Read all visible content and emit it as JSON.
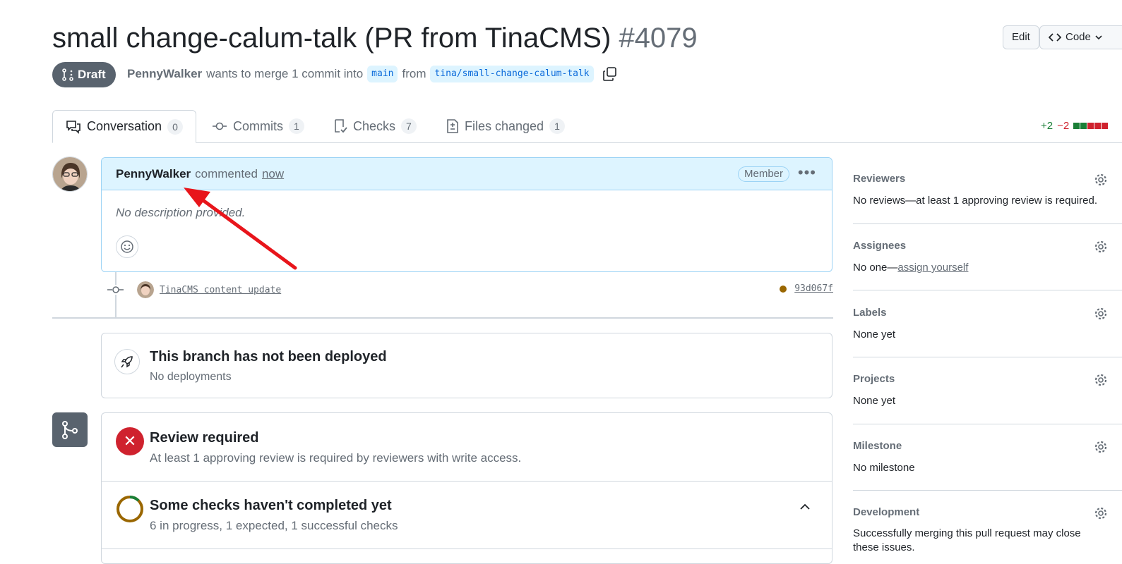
{
  "header": {
    "title": "small change-calum-talk (PR from TinaCMS)",
    "number": "#4079",
    "edit_label": "Edit",
    "code_label": "Code"
  },
  "state": {
    "badge": "Draft",
    "author": "PennyWalker",
    "merge_text": "wants to merge 1 commit into",
    "base_branch": "main",
    "from_text": "from",
    "head_branch": "tina/small-change-calum-talk"
  },
  "tabs": [
    {
      "label": "Conversation",
      "count": "0",
      "icon": "comment-discussion-icon"
    },
    {
      "label": "Commits",
      "count": "1",
      "icon": "git-commit-icon"
    },
    {
      "label": "Checks",
      "count": "7",
      "icon": "checklist-icon"
    },
    {
      "label": "Files changed",
      "count": "1",
      "icon": "file-diff-icon"
    }
  ],
  "diffstat": {
    "additions": "+2",
    "deletions": "−2"
  },
  "comment": {
    "author": "PennyWalker",
    "action": "commented",
    "time": "now",
    "role": "Member",
    "body": "No description provided."
  },
  "commit": {
    "message": "TinaCMS content update",
    "sha": "93d067f"
  },
  "deployment": {
    "title": "This branch has not been deployed",
    "subtitle": "No deployments"
  },
  "merge_box": {
    "review_title": "Review required",
    "review_sub": "At least 1 approving review is required by reviewers with write access.",
    "checks_title": "Some checks haven't completed yet",
    "checks_sub": "6 in progress, 1 expected, 1 successful checks"
  },
  "sidebar": {
    "reviewers_title": "Reviewers",
    "reviewers_value": "No reviews—at least 1 approving review is required.",
    "assignees_title": "Assignees",
    "assignees_prefix": "No one—",
    "assignees_link": "assign yourself",
    "labels_title": "Labels",
    "labels_value": "None yet",
    "projects_title": "Projects",
    "projects_value": "None yet",
    "milestone_title": "Milestone",
    "milestone_value": "No milestone",
    "development_title": "Development",
    "development_value": "Successfully merging this pull request may close these issues."
  },
  "colors": {
    "accent": "#0969da",
    "annotation": "#e8151b",
    "draft": "#59636e"
  }
}
